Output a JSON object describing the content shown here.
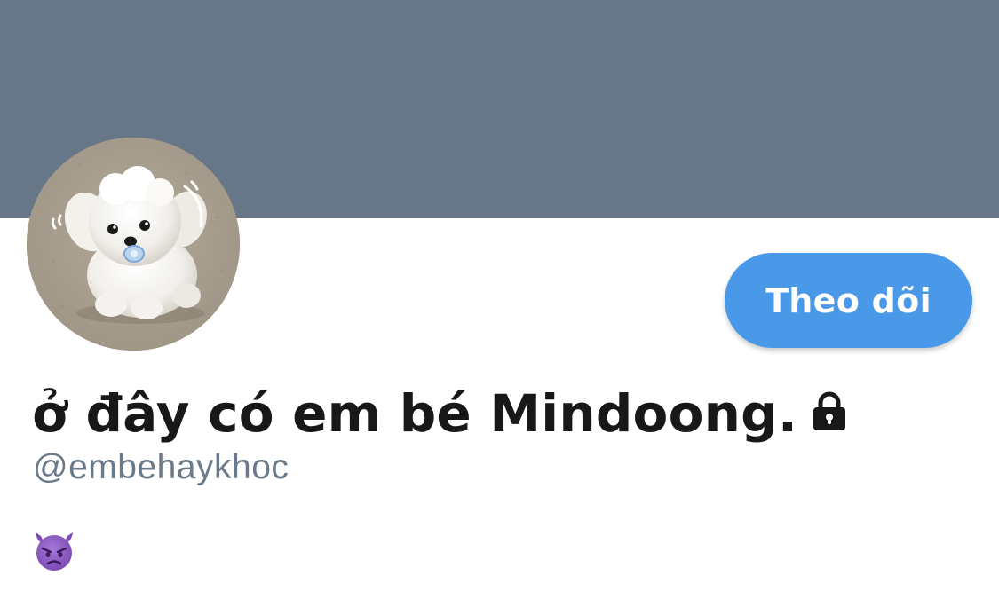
{
  "profile": {
    "display_name": "ở đây có em bé Mindoong.",
    "username": "@embehaykhoc",
    "protected_icon": "lock-icon",
    "bio_emoji_icon": "angry-devil-face-icon",
    "avatar_alt": "white puppy with pacifier"
  },
  "actions": {
    "follow_label": "Theo dõi"
  },
  "colors": {
    "banner": "#687787",
    "follow_button": "#4a99e9",
    "name_text": "#16181a",
    "username_text": "#6b7a88"
  }
}
